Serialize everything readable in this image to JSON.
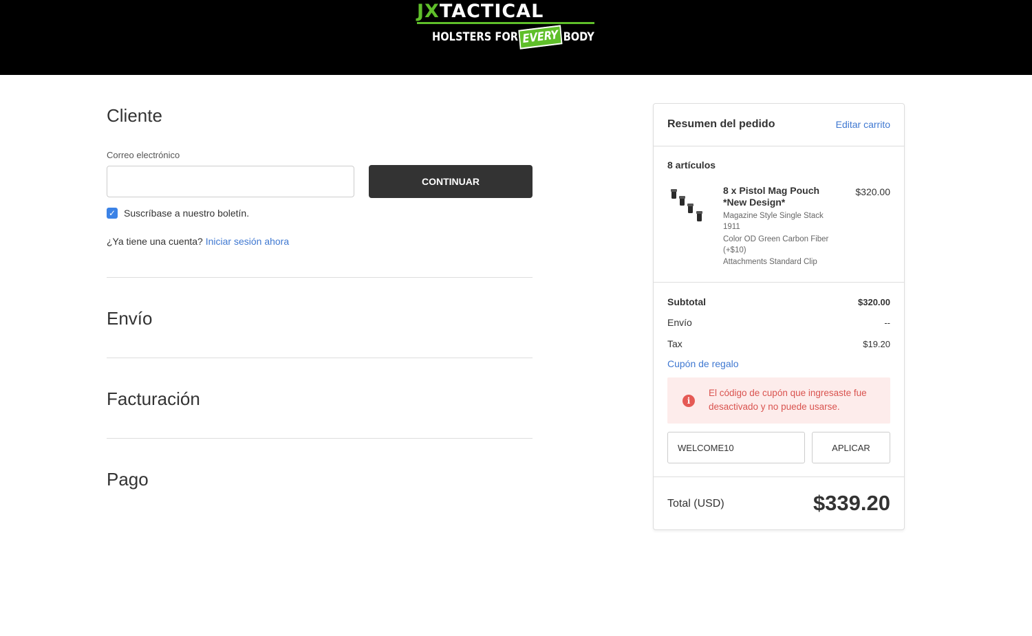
{
  "header": {
    "logo_brand_1": "JX",
    "logo_brand_2": "TACTICAL",
    "logo_tagline_1": "HOLSTERS FOR",
    "logo_tagline_every": "EVERY",
    "logo_tagline_2": "BODY"
  },
  "customer": {
    "title": "Cliente",
    "email_label": "Correo electrónico",
    "email_value": "",
    "continue_label": "CONTINUAR",
    "newsletter_label": "Suscríbase a nuestro boletín.",
    "newsletter_checked": true,
    "account_prompt": "¿Ya tiene una cuenta?",
    "signin_link": "Iniciar sesión ahora"
  },
  "sections": {
    "shipping": "Envío",
    "billing": "Facturación",
    "payment": "Pago"
  },
  "summary": {
    "title": "Resumen del pedido",
    "edit_cart": "Editar carrito",
    "items_count": "8 artículos",
    "product": {
      "name": "8 x Pistol Mag Pouch *New Design*",
      "price": "$320.00",
      "options": [
        "Magazine Style Single Stack 1911",
        "Color OD Green Carbon Fiber (+$10)",
        "Attachments Standard Clip"
      ]
    },
    "subtotal_label": "Subtotal",
    "subtotal_value": "$320.00",
    "shipping_label": "Envío",
    "shipping_value": "--",
    "tax_label": "Tax",
    "tax_value": "$19.20",
    "coupon_link": "Cupón de regalo",
    "coupon_error": "El código de cupón que ingresaste fue desactivado y no puede usarse.",
    "coupon_value": "WELCOME10",
    "apply_label": "APLICAR",
    "total_label": "Total (USD)",
    "total_value": "$339.20"
  },
  "colors": {
    "link": "#3f78d1",
    "button_dark": "#333333",
    "brand_green": "#5fbf2a",
    "error_text": "#d9534f",
    "error_bg": "#fdeceb",
    "checkbox": "#3b82e6"
  },
  "icons": [
    "checkbox-checked-icon",
    "alert-info-icon",
    "product-thumbnail"
  ]
}
